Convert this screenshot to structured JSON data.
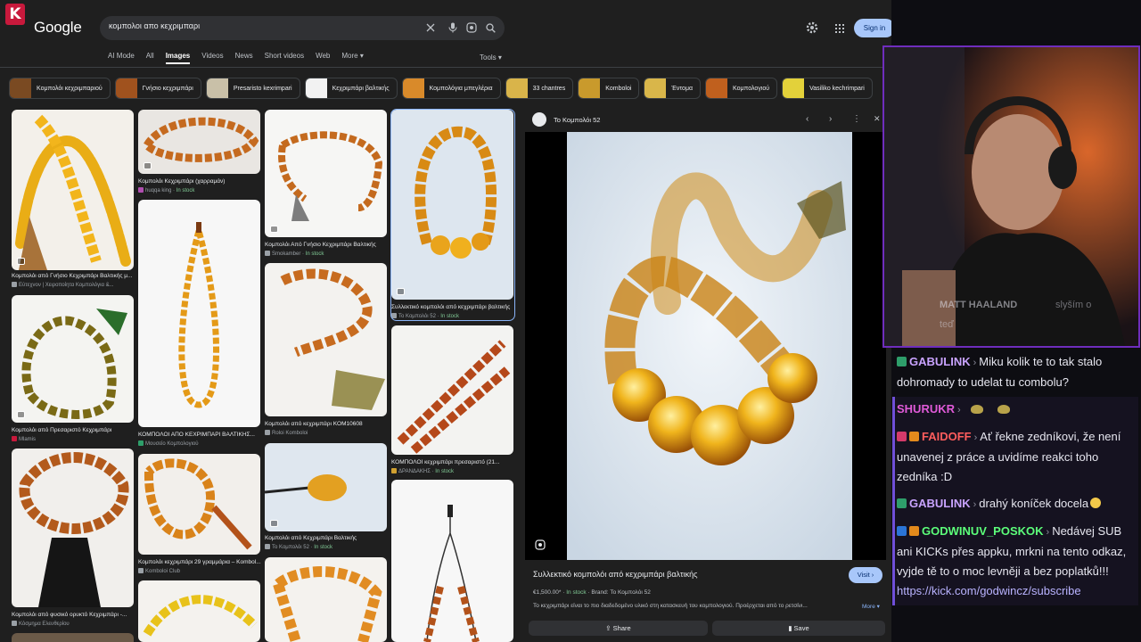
{
  "google": {
    "brand_badge": "K",
    "logo": "Google",
    "search": {
      "query": "κομπολοι απο κεχριμπαρι",
      "icons": [
        "clear-icon",
        "mic-icon",
        "lens-icon",
        "search-icon"
      ]
    },
    "settings_icon": "gear-icon",
    "apps_icon": "apps-grid-icon",
    "signin_label": "Sign in",
    "tabs": [
      {
        "label": "AI Mode"
      },
      {
        "label": "All"
      },
      {
        "label": "Images",
        "active": true
      },
      {
        "label": "Videos"
      },
      {
        "label": "News"
      },
      {
        "label": "Short videos"
      },
      {
        "label": "Web"
      },
      {
        "label": "More ▾"
      }
    ],
    "tools_label": "Tools ▾",
    "chips": [
      {
        "label": "Κομπολόι κεχριμπαριού",
        "color": "#7a4a22"
      },
      {
        "label": "Γνήσιο κεχριμπάρι",
        "color": "#a0521e"
      },
      {
        "label": "Presaristo kexrimpari",
        "color": "#c9c0a8"
      },
      {
        "label": "Κεχριμπάρι βαλτικής",
        "color": "#f2f2f2"
      },
      {
        "label": "Κομπολόγια μπεγλέρια",
        "color": "#d98a2a"
      },
      {
        "label": "33 chantres",
        "color": "#d9b44a"
      },
      {
        "label": "Komboloi",
        "color": "#c99a2c"
      },
      {
        "label": "Έντομα",
        "color": "#d9b64a"
      },
      {
        "label": "Κομπολογιού",
        "color": "#c0601e"
      },
      {
        "label": "Vasiliko kechrimpari",
        "color": "#e3d13a"
      }
    ],
    "results": [
      {
        "caption": "Κομπολόι από Γνήσιο Κεχριμπάρι Βαλτικής μ...",
        "source": "Εύτεχνον | Χειροποίητα Κομπολόγια &...",
        "stock": ""
      },
      {
        "caption": "Κομπολόι από Πρεσαριστό Κεχριμπάρι",
        "source": "Mlamis",
        "stock": ""
      },
      {
        "caption": "Κομπολόι από φυσικό ορυκτό Κεχριμπάρι -...",
        "source": "Κόσμημα Ελευθερίου",
        "stock": ""
      },
      {
        "caption": "Κομπολόι Κεχριμπάρι (χαρραμάν)",
        "source": "huqqa king",
        "stock": "In stock"
      },
      {
        "caption": "ΚΟΜΠΟΛΟΙ ΑΠΟ ΚΕΧΡΙΜΠΑΡΙ ΒΑΛΤΙΚΗΣ...",
        "source": "Μουσείο Κομπολογιού",
        "stock": ""
      },
      {
        "caption": "Κομπολόι κεχριμπάρι 29 γραμμάρια – Kombol...",
        "source": "Komboloi Club",
        "stock": ""
      },
      {
        "caption": "Κομπολόι Από Γνήσιο Κεχριμπάρι Βαλτικής",
        "source": "Smokamber",
        "stock": "In stock"
      },
      {
        "caption": "Κομπολόι από κεχριμπάρι KOM10608",
        "source": "Roloi Komboloi",
        "stock": ""
      },
      {
        "caption": "Κομπολόι από Κεχριμπάρι Βαλτικής",
        "source": "Το Κομπολόι 52",
        "stock": "In stock"
      },
      {
        "caption": "Συλλεκτικό κομπολόι από κεχριμπάρι βαλτικής",
        "source": "Το Κομπολόι 52",
        "stock": "In stock"
      },
      {
        "caption": "ΚΟΜΠΟΛΟΙ κεχριμπάρι πρεσαριστό (21...",
        "source": "ΔΡΑΝΔΑΚΗΣ",
        "stock": "In stock"
      },
      {
        "caption": "",
        "source": "",
        "stock": ""
      }
    ],
    "preview": {
      "site": "Το Κομπολόι 52",
      "title": "Συλλεκτικό κομπολόι από κεχριμπάρι βαλτικής",
      "price": "€1,500.00*",
      "stock": "In stock",
      "brand": "Brand: Το Κομπολόι 52",
      "description": "Το κεχριμπάρι είναι το πιο διαδεδομένο υλικό στη κατασκευή του κομπολογιού. Προέρχεται από το ρετσίνι...",
      "more_label": "More ▾",
      "visit_label": "Visit ›",
      "share_label": "Share",
      "save_label": "Save",
      "nav": [
        "‹",
        "›",
        "⋮",
        "✕"
      ]
    }
  },
  "stream": {
    "webcam_overlay": {
      "name": "MATT HAALAND",
      "message": "slyším o",
      "message_cont": "teď"
    },
    "chat": [
      {
        "user": "GABULINK",
        "color": "#c9a3ff",
        "badge_color": "#2e9e6a",
        "text": "Miku kolik te to tak stalo dohromady to udelat tu combolu?"
      },
      {
        "user": "SHURUKR",
        "color": "#e05ad8",
        "badge_color": "",
        "text": "",
        "emotes": 2
      },
      {
        "user": "FAIDOFF",
        "color": "#ff5d5d",
        "badge_color": "#d43a6a",
        "text": "Ať řekne zedníkovi, že není unavenej z práce a uvidíme reakci toho zedníka :D"
      },
      {
        "user": "GABULINK",
        "color": "#c9a3ff",
        "badge_color": "#2e9e6a",
        "text": "drahý koníček docela"
      },
      {
        "user": "GODWINUV_POSKOK",
        "color": "#5cff7a",
        "badge_color": "#2b74d6",
        "text": "Nedávej SUB ani KICKs přes appku, mrkni na tento odkaz, vyjde tě to o moc levněji a bez poplatků!!!",
        "link": "https://kick.com/godwincz/subscribe"
      }
    ]
  }
}
